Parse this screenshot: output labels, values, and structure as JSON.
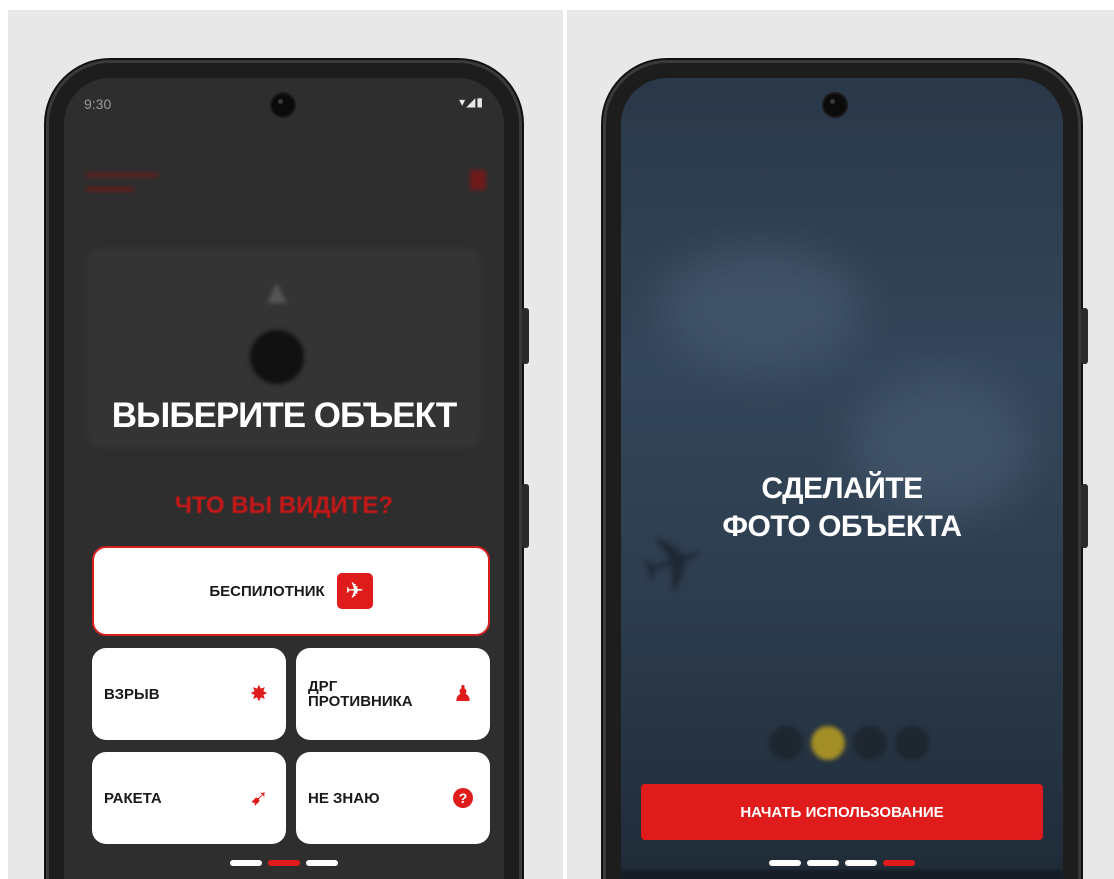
{
  "left_screen": {
    "status_time": "9:30",
    "status_icons": "▾◢▮",
    "overlay_title": "ВЫБЕРИТЕ ОБЪЕКТ",
    "question": "ЧТО ВЫ ВИДИТЕ?",
    "options": [
      {
        "label": "БЕСПИЛОТНИК",
        "icon": "airplane-icon",
        "glyph": "✈"
      },
      {
        "label": "ВЗРЫВ",
        "icon": "explosion-icon",
        "glyph": "✸"
      },
      {
        "label": "ДРГ ПРОТИВНИКА",
        "icon": "soldier-icon",
        "glyph": "♟"
      },
      {
        "label": "РАКЕТА",
        "icon": "rocket-icon",
        "glyph": "➹"
      },
      {
        "label": "НЕ ЗНАЮ",
        "icon": "question-icon",
        "glyph": "?"
      }
    ],
    "pager": {
      "count": 3,
      "active_index": 1
    }
  },
  "right_screen": {
    "title_line1": "СДЕЛАЙТЕ",
    "title_line2": "ФОТО ОБЪЕКТА",
    "start_button": "НАЧАТЬ ИСПОЛЬЗОВАНИЕ",
    "pager": {
      "count": 4,
      "active_index": 3
    }
  },
  "colors": {
    "accent": "#e01b1b",
    "question": "#c71818",
    "left_background": "#2e2e2e",
    "right_background": "#2e3e50"
  }
}
